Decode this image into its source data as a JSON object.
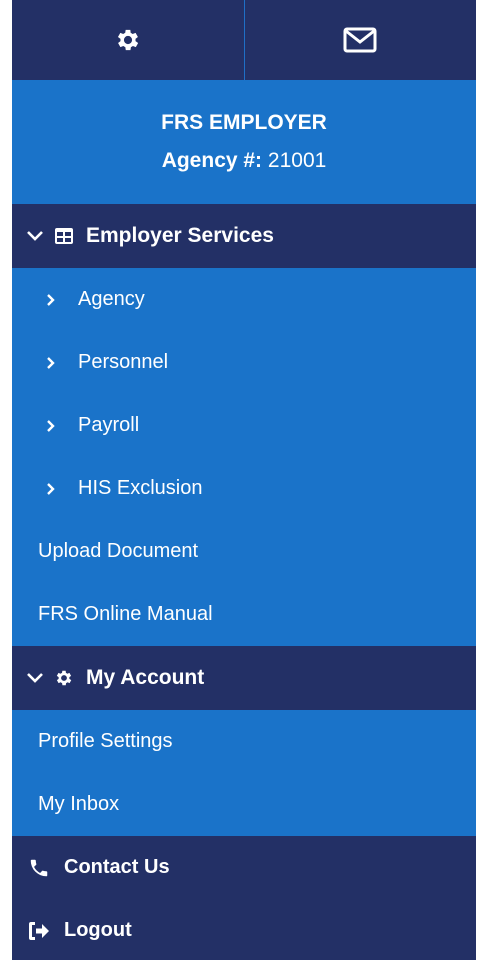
{
  "topbar": {
    "settings_icon": "gear-icon",
    "mail_icon": "envelope-icon"
  },
  "agency": {
    "name": "FRS EMPLOYER",
    "number_label": "Agency #:",
    "number_value": "21001"
  },
  "employer_services": {
    "label": "Employer Services",
    "expanded": true,
    "items": [
      {
        "label": "Agency"
      },
      {
        "label": "Personnel"
      },
      {
        "label": "Payroll"
      },
      {
        "label": "HIS Exclusion"
      }
    ]
  },
  "links": {
    "upload_document": "Upload Document",
    "online_manual": "FRS Online Manual"
  },
  "my_account": {
    "label": "My Account",
    "expanded": true,
    "items": [
      {
        "label": "Profile Settings"
      },
      {
        "label": "My Inbox"
      }
    ]
  },
  "bottom": {
    "contact": "Contact Us",
    "logout": "Logout"
  },
  "colors": {
    "dark_navy": "#233066",
    "bright_blue": "#1a73c9"
  }
}
